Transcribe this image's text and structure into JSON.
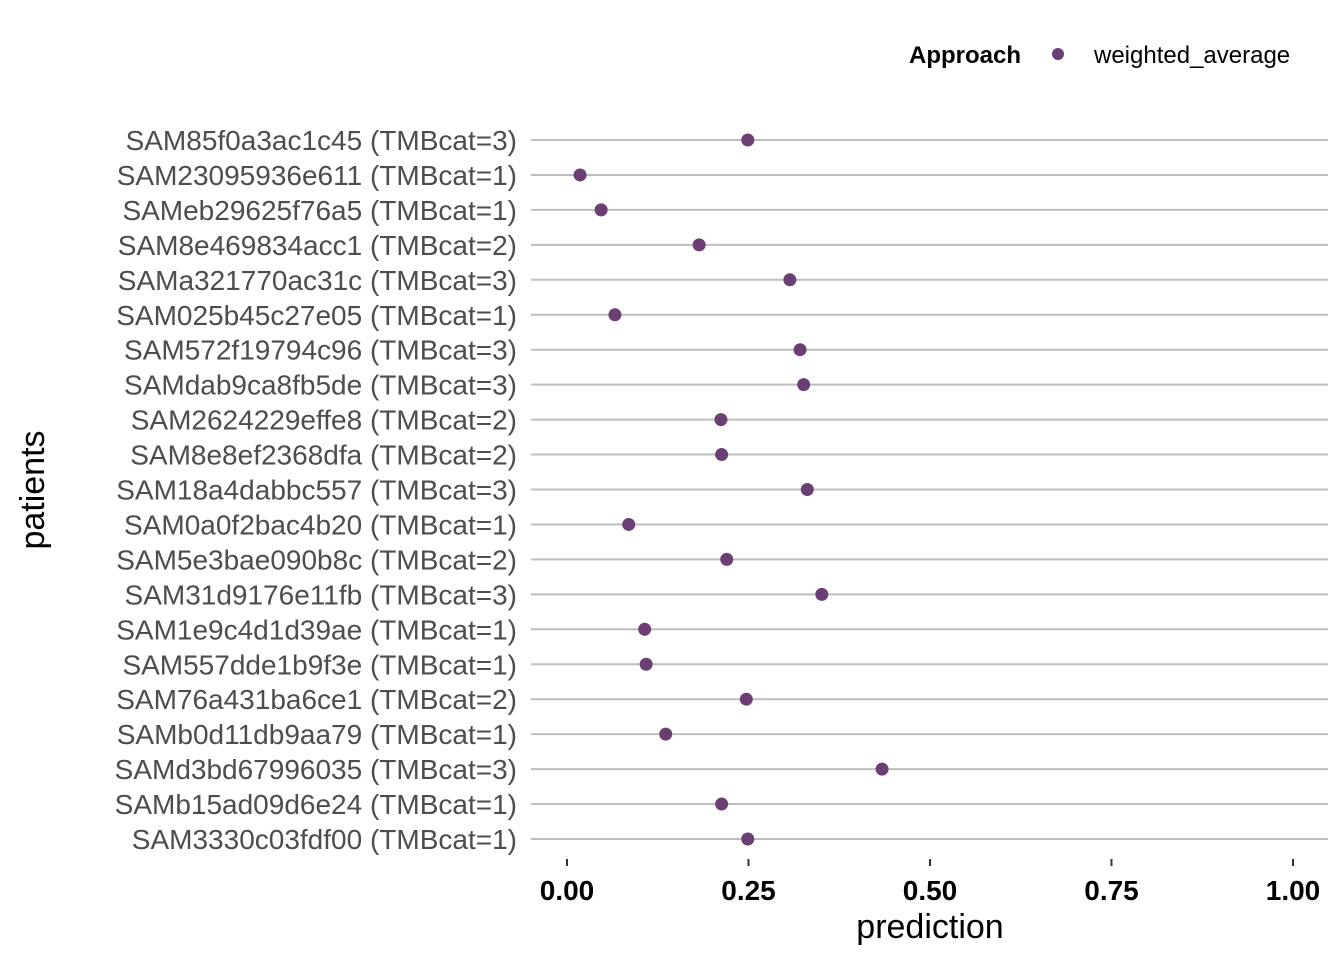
{
  "chart_data": {
    "type": "scatter",
    "title": "",
    "xlabel": "prediction",
    "ylabel": "patients",
    "xlim": [
      0,
      1
    ],
    "x_ticks": [
      0.0,
      0.25,
      0.5,
      0.75,
      1.0
    ],
    "x_tick_labels": [
      "0.00",
      "0.25",
      "0.50",
      "0.75",
      "1.00"
    ],
    "grid": "horizontal major only",
    "legend": {
      "position": "top-right",
      "title": "Approach",
      "entries": [
        {
          "label": "weighted_average",
          "color": "#6b3f74",
          "shape": "circle"
        }
      ]
    },
    "categories": [
      "SAM85f0a3ac1c45 (TMBcat=3)",
      "SAM23095936e611 (TMBcat=1)",
      "SAMeb29625f76a5 (TMBcat=1)",
      "SAM8e469834acc1 (TMBcat=2)",
      "SAMa321770ac31c (TMBcat=3)",
      "SAM025b45c27e05 (TMBcat=1)",
      "SAM572f19794c96 (TMBcat=3)",
      "SAMdab9ca8fb5de (TMBcat=3)",
      "SAM2624229effe8 (TMBcat=2)",
      "SAM8e8ef2368dfa (TMBcat=2)",
      "SAM18a4dabbc557 (TMBcat=3)",
      "SAM0a0f2bac4b20 (TMBcat=1)",
      "SAM5e3bae090b8c (TMBcat=2)",
      "SAM31d9176e11fb (TMBcat=3)",
      "SAM1e9c4d1d39ae (TMBcat=1)",
      "SAM557dde1b9f3e (TMBcat=1)",
      "SAM76a431ba6ce1 (TMBcat=2)",
      "SAMb0d11db9aa79 (TMBcat=1)",
      "SAMd3bd67996035 (TMBcat=3)",
      "SAMb15ad09d6e24 (TMBcat=1)",
      "SAM3330c03fdf00 (TMBcat=1)"
    ],
    "series": [
      {
        "name": "weighted_average",
        "color": "#6b3f74",
        "values": [
          0.249,
          0.018,
          0.047,
          0.182,
          0.307,
          0.066,
          0.321,
          0.326,
          0.212,
          0.213,
          0.331,
          0.085,
          0.22,
          0.351,
          0.107,
          0.109,
          0.247,
          0.136,
          0.434,
          0.213,
          0.249
        ]
      }
    ]
  }
}
